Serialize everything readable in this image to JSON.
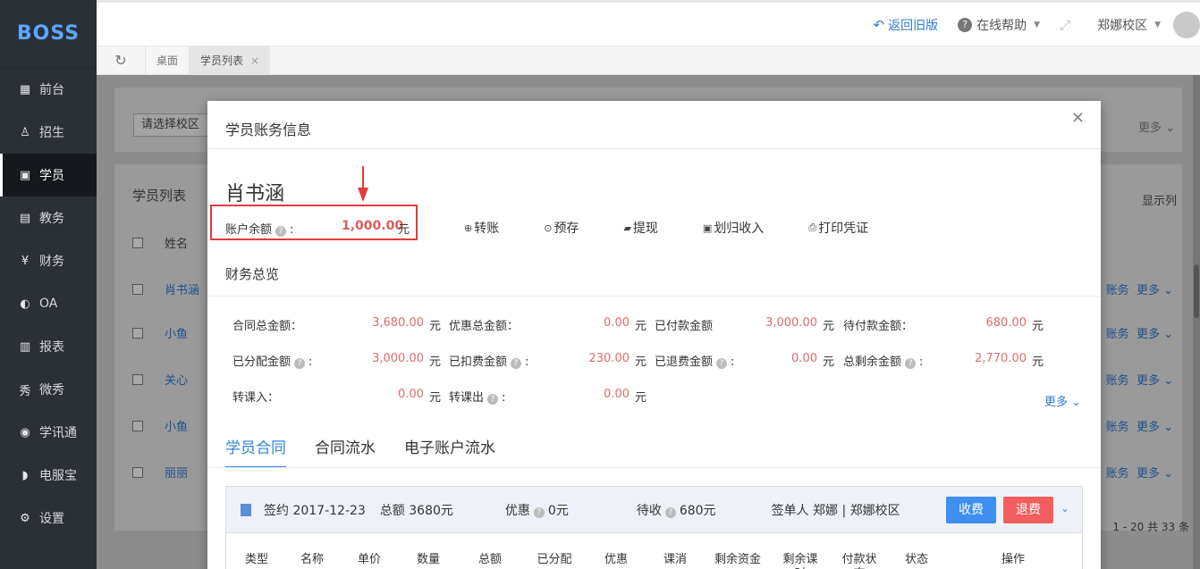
{
  "sidebar": {
    "logo": "BOSS",
    "items": [
      {
        "label": "前台",
        "icon": "calendar-icon"
      },
      {
        "label": "招生",
        "icon": "add-user-icon"
      },
      {
        "label": "学员",
        "icon": "student-icon"
      },
      {
        "label": "教务",
        "icon": "book-icon"
      },
      {
        "label": "财务",
        "icon": "yen-icon"
      },
      {
        "label": "OA",
        "icon": "toggle-icon"
      },
      {
        "label": "报表",
        "icon": "bar-chart-icon"
      },
      {
        "label": "微秀",
        "icon": "show-icon"
      },
      {
        "label": "学讯通",
        "icon": "location-icon"
      },
      {
        "label": "电服宝",
        "icon": "phone-service-icon"
      },
      {
        "label": "设置",
        "icon": "gear-icon"
      }
    ],
    "active_index": 2
  },
  "topbar": {
    "back_old": "返回旧版",
    "help": "在线帮助",
    "campus": "郑娜校区"
  },
  "tabs": [
    {
      "label": "桌面"
    },
    {
      "label": "学员列表"
    }
  ],
  "background": {
    "campus_select": "请选择校区",
    "more": "更多",
    "list_title": "学员列表",
    "show_columns": "显示列",
    "col_name": "姓名",
    "rows": [
      "肖书涵",
      "小鱼",
      "关心",
      "小鱼",
      "丽丽"
    ],
    "row_action_account": "账务",
    "row_action_more": "更多",
    "pager": "1 - 20  共 33 条"
  },
  "modal": {
    "title": "学员账务信息",
    "student_name": "肖书涵",
    "balance_label": "账户余额",
    "balance_value": "1,000.00",
    "balance_unit": "元",
    "actions": [
      "转账",
      "预存",
      "提现",
      "划归收入",
      "打印凭证"
    ],
    "finance_title": "财务总览",
    "finance": [
      {
        "label": "合同总金额：",
        "value": "3,680.00",
        "unit": "元",
        "help": false
      },
      {
        "label": "优惠总金额：",
        "value": "0.00",
        "unit": "元",
        "help": false
      },
      {
        "label": "已付款金额",
        "value": "3,000.00",
        "unit": "元",
        "help": false
      },
      {
        "label": "待付款金额：",
        "value": "680.00",
        "unit": "元",
        "help": false
      },
      {
        "label": "已分配金额",
        "value": "3,000.00",
        "unit": "元",
        "help": true
      },
      {
        "label": "已扣费金额",
        "value": "230.00",
        "unit": "元",
        "help": true
      },
      {
        "label": "已退费金额",
        "value": "0.00",
        "unit": "元",
        "help": true
      },
      {
        "label": "总剩余金额",
        "value": "2,770.00",
        "unit": "元",
        "help": true
      },
      {
        "label": "转课入：",
        "value": "0.00",
        "unit": "元",
        "help": false
      },
      {
        "label": "转课出",
        "value": "0.00",
        "unit": "元",
        "help": true
      }
    ],
    "finance_more": "更多",
    "tabs": [
      "学员合同",
      "合同流水",
      "电子账户流水"
    ],
    "contract": {
      "sign": "签约 2017-12-23",
      "total": "总额 3680元",
      "discount_label": "优惠",
      "discount_value": "0元",
      "pending_label": "待收",
      "pending_value": "680元",
      "signer": "签单人 郑娜 | 郑娜校区",
      "charge_btn": "收费",
      "refund_btn": "退费",
      "columns": [
        "类型",
        "名称",
        "单价",
        "数量",
        "总额",
        "已分配",
        "优惠",
        "课消",
        "剩余资金",
        "剩余课时",
        "付款状态",
        "状态",
        "操作"
      ]
    }
  }
}
